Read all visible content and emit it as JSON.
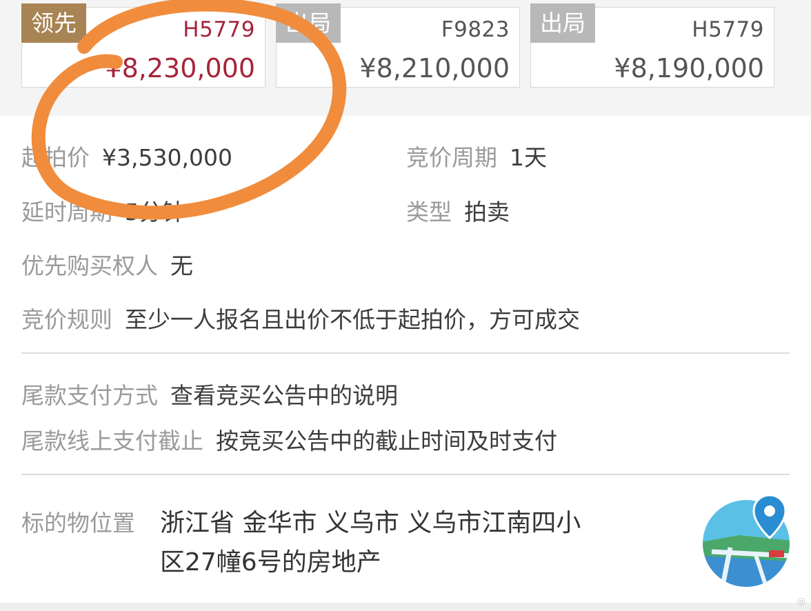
{
  "bids": [
    {
      "tag": "领先",
      "id": "H5779",
      "amount": "¥8,230,000"
    },
    {
      "tag": "出局",
      "id": "F9823",
      "amount": "¥8,210,000"
    },
    {
      "tag": "出局",
      "id": "H5779",
      "amount": "¥8,190,000"
    }
  ],
  "info": {
    "start_price_label": "起拍价",
    "start_price_value": "¥3,530,000",
    "cycle_label": "竞价周期",
    "cycle_value": "1天",
    "delay_label": "延时周期",
    "delay_value": "5分钟",
    "type_label": "类型",
    "type_value": "拍卖",
    "priority_label": "优先购买权人",
    "priority_value": "无",
    "rule_label": "竞价规则",
    "rule_value": "至少一人报名且出价不低于起拍价，方可成交"
  },
  "payment": {
    "method_label": "尾款支付方式",
    "method_value": "查看竞买公告中的说明",
    "deadline_label": "尾款线上支付截止",
    "deadline_value": "按竞买公告中的截止时间及时支付"
  },
  "location": {
    "label": "标的物位置",
    "value": "浙江省 金华市 义乌市 义乌市江南四小区27幢6号的房地产"
  },
  "map_icon": "map-pin-icon",
  "annotation_color": "#f08c3c",
  "accent_colors": {
    "lead_price": "#a5243a",
    "lead_tag": "#a88454",
    "out_tag": "#b8b8b8"
  }
}
